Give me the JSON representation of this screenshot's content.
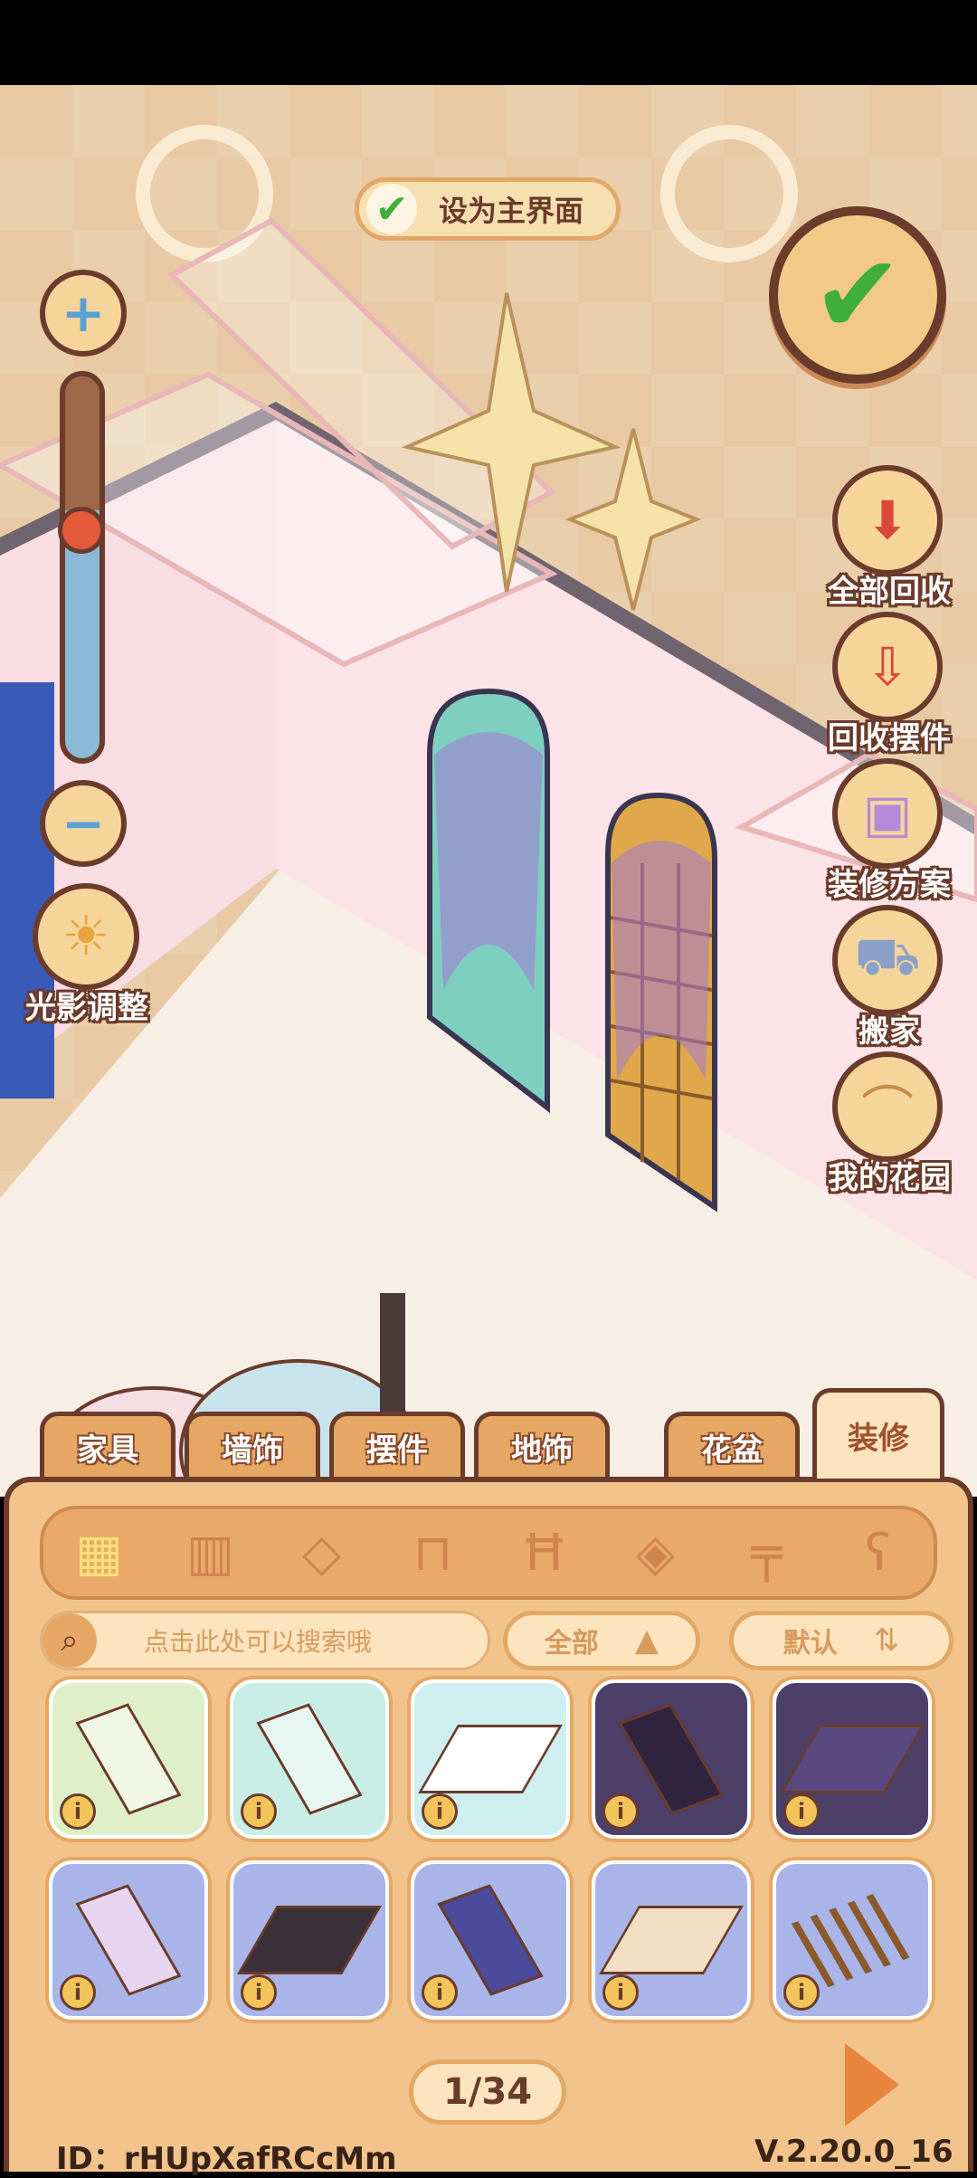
{
  "top": {
    "set_main_label": "设为主界面"
  },
  "zoom": {
    "plus": "+",
    "minus": "−",
    "level": 0.35
  },
  "side_buttons": [
    {
      "label": "全部回收",
      "icon": "recycle-all-box-icon"
    },
    {
      "label": "回收摆件",
      "icon": "recycle-ornament-icon"
    },
    {
      "label": "装修方案",
      "icon": "decoration-plan-icon"
    },
    {
      "label": "搬家",
      "icon": "moving-truck-icon"
    },
    {
      "label": "我的花园",
      "icon": "garden-arch-icon"
    }
  ],
  "light_adjust": {
    "label": "光影调整"
  },
  "tabs": [
    {
      "label": "家具",
      "active": false
    },
    {
      "label": "墙饰",
      "active": false
    },
    {
      "label": "摆件",
      "active": false
    },
    {
      "label": "地饰",
      "active": false
    },
    {
      "label": "花盆",
      "active": false
    },
    {
      "label": "装修",
      "active": true
    }
  ],
  "categories": [
    "all-grid-icon",
    "wallpaper-icon",
    "floor-tile-icon",
    "window-icon",
    "fence-icon",
    "floor-pattern-icon",
    "railing-icon",
    "lamp-post-icon"
  ],
  "search": {
    "placeholder": "点击此处可以搜索哦"
  },
  "filter": {
    "label": "全部"
  },
  "sort": {
    "label": "默认"
  },
  "items": [
    {
      "bg": "#dff0c8",
      "thumb": "#f3f7e6",
      "shape": "wall"
    },
    {
      "bg": "#c9eee6",
      "thumb": "#e8f6f2",
      "shape": "wall"
    },
    {
      "bg": "#cfeef0",
      "thumb": "#ffffff",
      "shape": "floor"
    },
    {
      "bg": "#4c3f68",
      "thumb": "#2e2440",
      "shape": "wall"
    },
    {
      "bg": "#4c3f68",
      "thumb": "#5a4a82",
      "shape": "floor"
    },
    {
      "bg": "#a9b5e8",
      "thumb": "#e6d4f0",
      "shape": "wall"
    },
    {
      "bg": "#a9b5e8",
      "thumb": "#3a3038",
      "shape": "floor"
    },
    {
      "bg": "#a9b5e8",
      "thumb": "#4c4a9a",
      "shape": "wall"
    },
    {
      "bg": "#a9b5e8",
      "thumb": "#f2dfc4",
      "shape": "floor"
    },
    {
      "bg": "#a9b5e8",
      "thumb": "#8a5a2a",
      "shape": "fence"
    }
  ],
  "info_glyph": "i",
  "pagination": {
    "current": "1/34"
  },
  "footer": {
    "user_id": "ID：rHUpXafRCcMm",
    "version": "V.2.20.0_16"
  }
}
